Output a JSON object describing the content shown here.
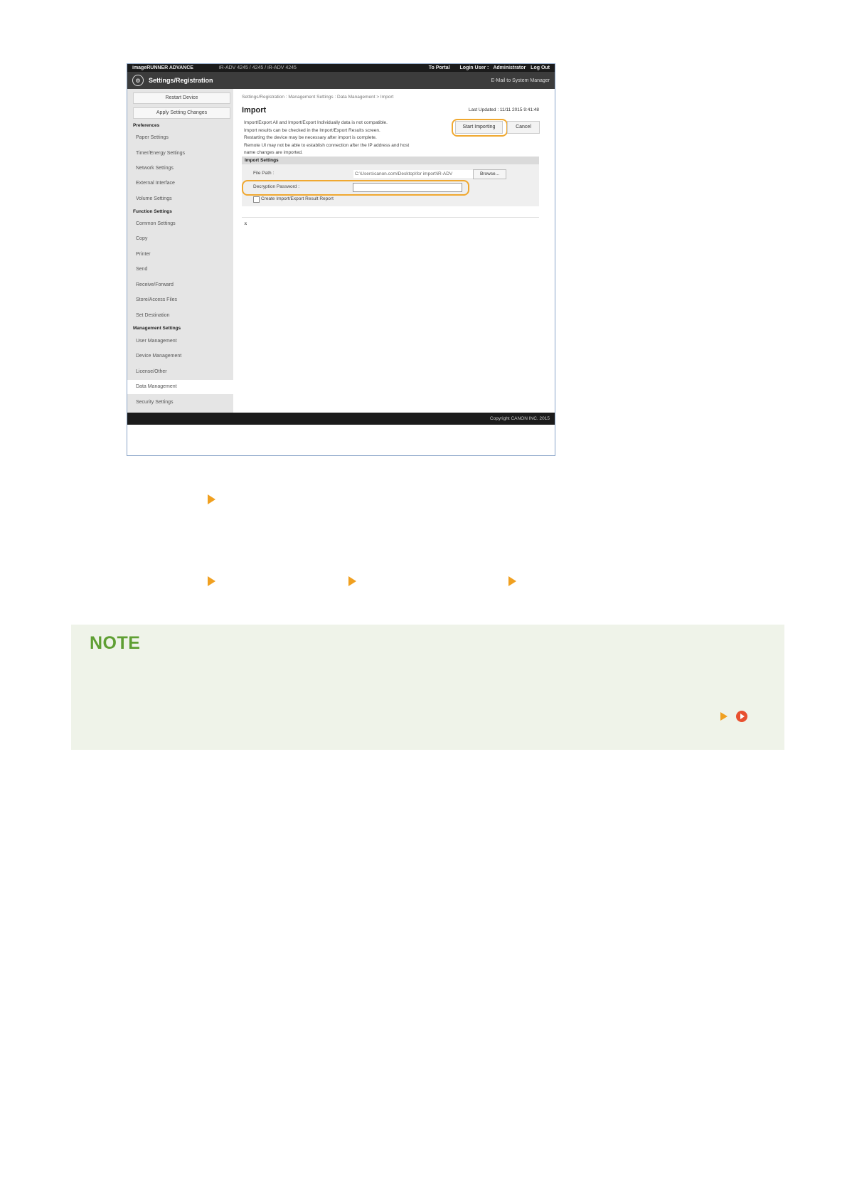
{
  "screenshot": {
    "topbar": {
      "brand": "imageRUNNER ADVANCE",
      "address": "iR-ADV 4245 / 4245 / iR-ADV 4245",
      "links": [
        "To Portal",
        "Login User :",
        "Administrator",
        "Log Out"
      ]
    },
    "titlebar": {
      "title": "Settings/Registration",
      "mail": "E-Mail to System Manager"
    },
    "sidebar": {
      "restart": "Restart Device",
      "apply": "Apply Setting Changes",
      "sections": [
        {
          "heading": "Preferences",
          "items": [
            "Paper Settings",
            "Timer/Energy Settings",
            "Network Settings",
            "External Interface",
            "Volume Settings"
          ]
        },
        {
          "heading": "Function Settings",
          "items": [
            "Common Settings",
            "Copy",
            "Printer",
            "Send",
            "Receive/Forward",
            "Store/Access Files",
            "Set Destination"
          ]
        },
        {
          "heading": "Management Settings",
          "items": [
            "User Management",
            "Device Management",
            "License/Other",
            "Data Management",
            "Security Settings"
          ]
        }
      ],
      "selected": "Data Management"
    },
    "main": {
      "breadcrumb": "Settings/Registration : Management Settings : Data Management > Import",
      "title": "Import",
      "updated": "Last Updated : 11/11 2015 9:41:48",
      "description": [
        "Import/Export All and Import/Export Individually data is not compatible.",
        "Import results can be checked in the Import/Export Results screen.",
        "Restarting the device may be necessary after import is complete.",
        "Remote UI may not be able to establish connection after the IP address and host",
        "name changes are imported."
      ],
      "start_button": "Start Importing",
      "cancel_button": "Cancel",
      "section_title": "Import Settings",
      "file_path_label": "File Path :",
      "file_path_value": "C:\\Users\\canon.com\\Desktop\\for import\\iR-ADV",
      "browse_button": "Browse...",
      "password_label": "Decryption Password :",
      "password_value": "",
      "checkbox_label": "Create Import/Export Result Report",
      "top_link": "⌅"
    },
    "footer": "Copyright CANON INC. 2015"
  },
  "note": {
    "title": "NOTE"
  },
  "colors": {
    "accent_orange": "#f0a020",
    "note_green": "#5f9f33",
    "note_bg": "#eff3e9",
    "link_red": "#e8502f"
  }
}
